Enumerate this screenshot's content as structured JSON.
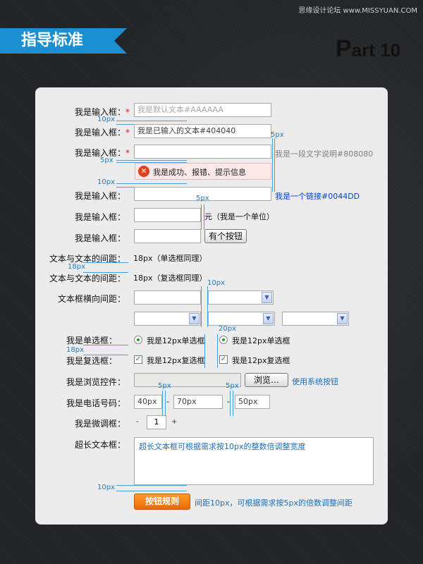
{
  "watermark": "思缘设计论坛 www.MISSYUAN.COM",
  "header": {
    "ribbon_title": "指导标准",
    "part_big": "P",
    "part_rest": "art 10"
  },
  "rows": {
    "r1": {
      "label": "我是输入框：",
      "req": "*",
      "placeholder": "我是默认文本#AAAAAA"
    },
    "r2": {
      "label": "我是输入框：",
      "req": "*",
      "value": "我是已输入的文本#404040"
    },
    "r3": {
      "label": "我是输入框：",
      "req": "*",
      "description": "我是一段文字说明#808080",
      "message": "我是成功、报错、提示信息"
    },
    "r4": {
      "label": "我是输入框：",
      "link": "我是一个链接#0044DD"
    },
    "r5": {
      "label": "我是输入框：",
      "unit": "元（我是一个单位）"
    },
    "r6": {
      "label": "我是输入框：",
      "button": "有个按钮"
    },
    "r7": {
      "label": "文本与文本的间距：",
      "text": "18px（单选框同理）"
    },
    "r8": {
      "label": "文本与文本的间距：",
      "text": "18px（复选框同理）"
    },
    "r9": {
      "label": "文本框横向间距："
    },
    "radio": {
      "label": "我是单选框：",
      "opt1": "我是12px单选框",
      "opt2": "我是12px单选框"
    },
    "checkbox": {
      "label": "我是复选框：",
      "opt1": "我是12px复选框",
      "opt2": "我是12px复选框"
    },
    "browse": {
      "label": "我是浏览控件：",
      "button": "浏览…",
      "hint": "使用系统按钮"
    },
    "phone": {
      "label": "我是电话号码：",
      "v1": "40px",
      "v2": "70px",
      "v3": "50px",
      "sep": "-"
    },
    "stepper": {
      "label": "我是微调框：",
      "minus": "-",
      "value": "1",
      "plus": "+"
    },
    "longtext": {
      "label": "超长文本框：",
      "value": "超长文本框可根据需求按10px的整数倍调整宽度"
    },
    "submit": {
      "button": "按钮规则",
      "hint": "间距10px，可根据需求按5px的倍数调整间距"
    }
  },
  "annotations": {
    "a1": "10px",
    "a2": "5px",
    "a3": "5px",
    "a4": "10px",
    "a5": "5px",
    "a6": "18px",
    "a7": "10px",
    "a8": "20px",
    "a9": "18px",
    "a10": "5px",
    "a11": "5px",
    "a12": "10px"
  },
  "colors": {
    "accent": "#1b8fd2",
    "placeholder": "#aaaaaa",
    "input_text": "#404040",
    "description": "#808080",
    "link": "#0044dd",
    "button_orange": "#f08010"
  }
}
